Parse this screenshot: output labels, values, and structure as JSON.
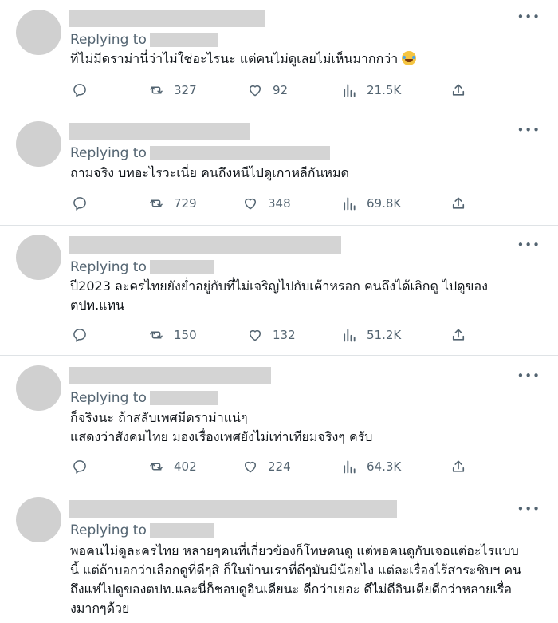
{
  "reply_prefix": "Replying to",
  "colors": {
    "text": "#0f1419",
    "muted": "#536471",
    "divider": "#dfe3e6",
    "placeholder": "#d4d4d4"
  },
  "tweets": [
    {
      "lines": [
        "ที่ไม่มีดราม่านี่ว่าไม่ใช่อะไรนะ  แต่คนไม่ดูเลยไม่เห็นมากกว่า"
      ],
      "emoji": "face-with-tears-of-joy",
      "replies": "",
      "retweets": "327",
      "likes": "92",
      "views": "21.5K"
    },
    {
      "lines": [
        "ถามจริง บทอะไรวะเนี่ย คนถึงหนีไปดูเกาหลีกันหมด"
      ],
      "replies": "",
      "retweets": "729",
      "likes": "348",
      "views": "69.8K"
    },
    {
      "lines": [
        "ปี2023 ละครไทยยังย่ำอยู่กับที่ไม่เจริญไปกับเค้าหรอก คนถึงได้เลิกดู ไปดูของ",
        "ตปท.แทน"
      ],
      "replies": "",
      "retweets": "150",
      "likes": "132",
      "views": "51.2K"
    },
    {
      "lines": [
        "ก็จริงนะ ถ้าสลับเพศมีดราม่าแน่ๆ",
        "แสดงว่าสังคมไทย มองเรื่องเพศยังไม่เท่าเทียมจริงๆ ครับ"
      ],
      "replies": "",
      "retweets": "402",
      "likes": "224",
      "views": "64.3K"
    },
    {
      "lines": [
        "พอคนไม่ดูละครไทย หลายๆคนที่เกี่ยวข้องก็โทษคนดู แต่พอคนดูกับเจอแต่อะไรแบบ",
        "นี้ แต่ถ้าบอกว่าเลือกดูที่ดีๆสิ ก็ในบ้านเราที่ดีๆมันมีน้อยไง แต่ละเรื่องไร้สาระชิบฯ คน",
        "ถึงแห่ไปดูของตปท.และนี่ก็ชอบดูอินเดียนะ ดีกว่าเยอะ ดีไม่ดีอินเดียดีกว่าหลายเรื่อ",
        "งมากๆด้วย"
      ],
      "replies": "",
      "retweets": "",
      "likes": "",
      "views": ""
    }
  ]
}
